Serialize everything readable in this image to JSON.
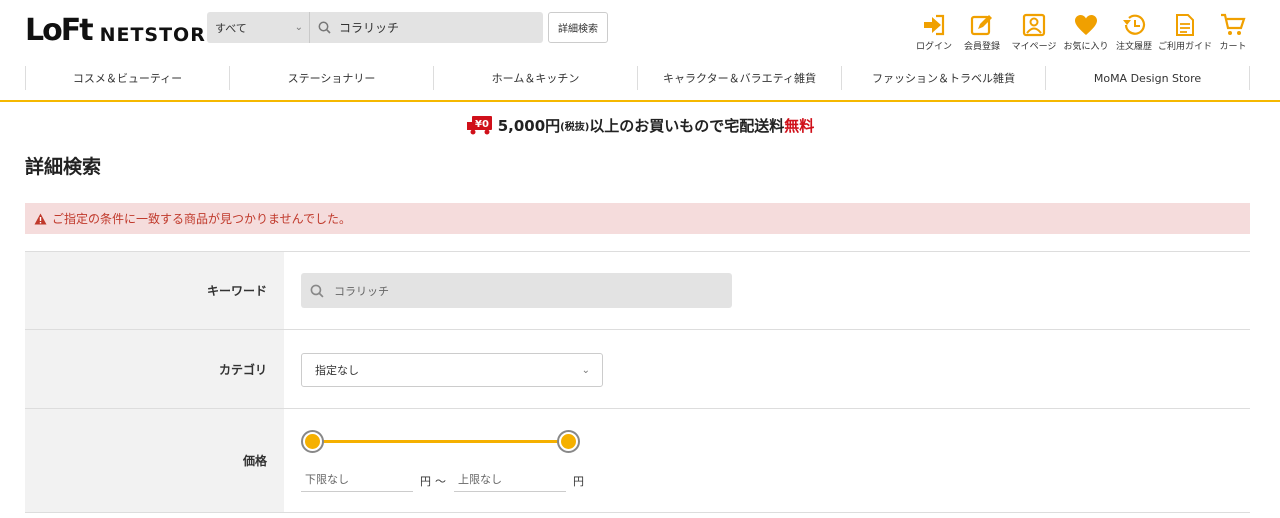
{
  "header": {
    "logo_main": "LoFt",
    "logo_sub": "NETSTORE",
    "search_scope": "すべて",
    "search_value": "コラリッチ",
    "advanced_search_label": "詳細検索",
    "utility": [
      {
        "label": "ログイン",
        "icon": "login-icon"
      },
      {
        "label": "会員登録",
        "icon": "register-icon"
      },
      {
        "label": "マイページ",
        "icon": "mypage-icon"
      },
      {
        "label": "お気に入り",
        "icon": "heart-icon"
      },
      {
        "label": "注文履歴",
        "icon": "history-icon"
      },
      {
        "label": "ご利用ガイド",
        "icon": "guide-icon"
      },
      {
        "label": "カート",
        "icon": "cart-icon"
      }
    ]
  },
  "nav": {
    "categories": [
      "コスメ＆ビューティー",
      "ステーショナリー",
      "ホーム＆キッチン",
      "キャラクター＆バラエティ雑貨",
      "ファッション＆トラベル雑貨",
      "MoMA Design Store"
    ]
  },
  "banner": {
    "truck_text": "¥0",
    "amount": "5,000円",
    "tax": "(税抜)",
    "text": "以上のお買いもので宅配送料",
    "free": "無料"
  },
  "page": {
    "title": "詳細検索",
    "alert": "ご指定の条件に一致する商品が見つかりませんでした。"
  },
  "form": {
    "keyword_label": "キーワード",
    "keyword_value": "コラリッチ",
    "category_label": "カテゴリ",
    "category_value": "指定なし",
    "price_label": "価格",
    "price_min_placeholder": "下限なし",
    "price_max_placeholder": "上限なし",
    "yen": "円",
    "tilde": "〜"
  },
  "colors": {
    "accent": "#f5b000",
    "alert_bg": "#f5dcdc",
    "alert_text": "#c0392b",
    "free_red": "#d0101a"
  }
}
